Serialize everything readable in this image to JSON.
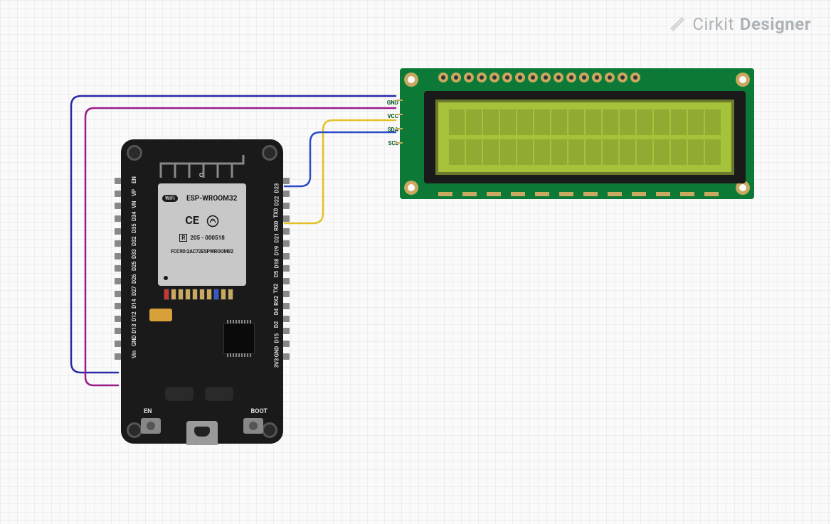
{
  "watermark": {
    "brand": "Cirkit",
    "suffix": "Designer"
  },
  "components": {
    "esp32": {
      "module_name": "ESP-WROOM32",
      "serial": "205 - 000518",
      "fcc": "FCC9D:2AC72ESPWROOM82",
      "cert_marks": "CE",
      "reg_mark": "R",
      "wifi_label": "WiFi",
      "antenna_label": "C",
      "buttons": {
        "en": "EN",
        "boot": "BOOT"
      },
      "pins_left": [
        "EN",
        "VP",
        "VN",
        "D34",
        "D35",
        "D32",
        "D33",
        "D25",
        "D26",
        "D27",
        "D14",
        "D12",
        "D13",
        "GND",
        "Vin"
      ],
      "pins_right": [
        "D23",
        "D22",
        "TX0",
        "RX0",
        "D21",
        "D19",
        "D18",
        "D5",
        "TX2",
        "RX2",
        "D4",
        "D2",
        "D15",
        "GND",
        "3V3"
      ]
    },
    "lcd": {
      "type": "I2C 16x2 LCD",
      "pins": [
        "GND",
        "VCC",
        "SDA",
        "SCL"
      ],
      "cols": 16,
      "rows": 2
    }
  },
  "wires": [
    {
      "name": "GND",
      "color": "#2a2aa8",
      "from": "esp32.GND(left)",
      "to": "lcd.GND"
    },
    {
      "name": "VCC",
      "color": "#9a1a8a",
      "from": "esp32.Vin",
      "to": "lcd.VCC"
    },
    {
      "name": "SDA",
      "color": "#e6c228",
      "from": "esp32.D21",
      "to": "lcd.SDA"
    },
    {
      "name": "SCL",
      "color": "#2a4ac8",
      "from": "esp32.D22",
      "to": "lcd.SCL"
    }
  ]
}
